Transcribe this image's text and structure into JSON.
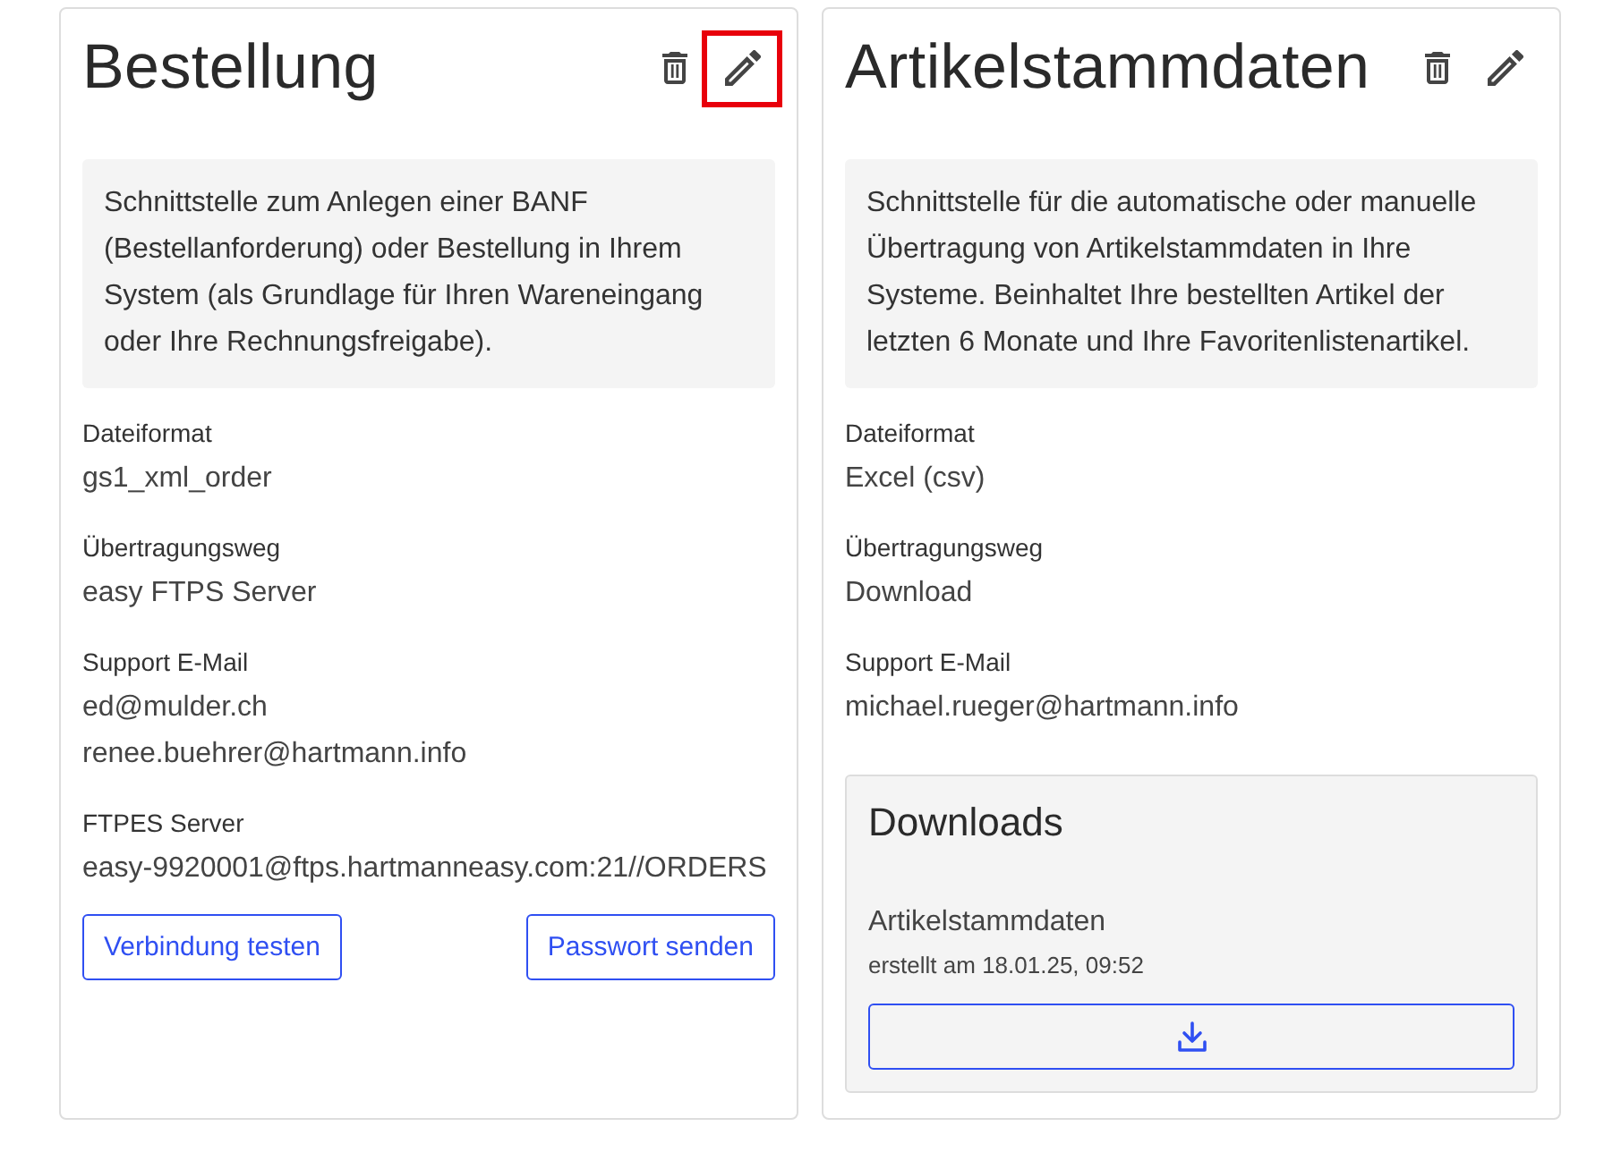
{
  "cards": [
    {
      "title": "Bestellung",
      "actions": [
        {
          "kind": "delete",
          "highlighted": false
        },
        {
          "kind": "edit",
          "highlighted": true
        }
      ],
      "description": "Schnittstelle zum Anlegen einer BANF (Bestellanforderung) oder Bestellung in Ihrem System (als Grundlage für Ihren Wareneingang oder Ihre Rechnungsfreigabe).",
      "fields": [
        {
          "label": "Dateiformat",
          "values": [
            "gs1_xml_order"
          ]
        },
        {
          "label": "Übertragungsweg",
          "values": [
            "easy FTPS Server"
          ]
        },
        {
          "label": "Support E-Mail",
          "values": [
            "ed@mulder.ch",
            "renee.buehrer@hartmann.info"
          ]
        },
        {
          "label": "FTPES Server",
          "values": [
            "easy-9920001@ftps.hartmanneasy.com:21//ORDERS"
          ]
        }
      ],
      "buttons": [
        "Verbindung testen",
        "Passwort senden"
      ]
    },
    {
      "title": "Artikelstammdaten",
      "actions": [
        {
          "kind": "delete",
          "highlighted": false
        },
        {
          "kind": "edit",
          "highlighted": false
        }
      ],
      "description": "Schnittstelle für die automatische oder manuelle Übertragung von Artikelstammdaten in Ihre Systeme. Beinhaltet Ihre bestellten Artikel der letzten 6 Monate und Ihre Favoritenlistenartikel.",
      "fields": [
        {
          "label": "Dateiformat",
          "values": [
            "Excel (csv)"
          ]
        },
        {
          "label": "Übertragungsweg",
          "values": [
            "Download"
          ]
        },
        {
          "label": "Support E-Mail",
          "values": [
            "michael.rueger@hartmann.info"
          ]
        }
      ],
      "downloads": {
        "title": "Downloads",
        "items": [
          {
            "name": "Artikelstammdaten",
            "created": "erstellt am 18.01.25, 09:52"
          }
        ]
      }
    }
  ]
}
